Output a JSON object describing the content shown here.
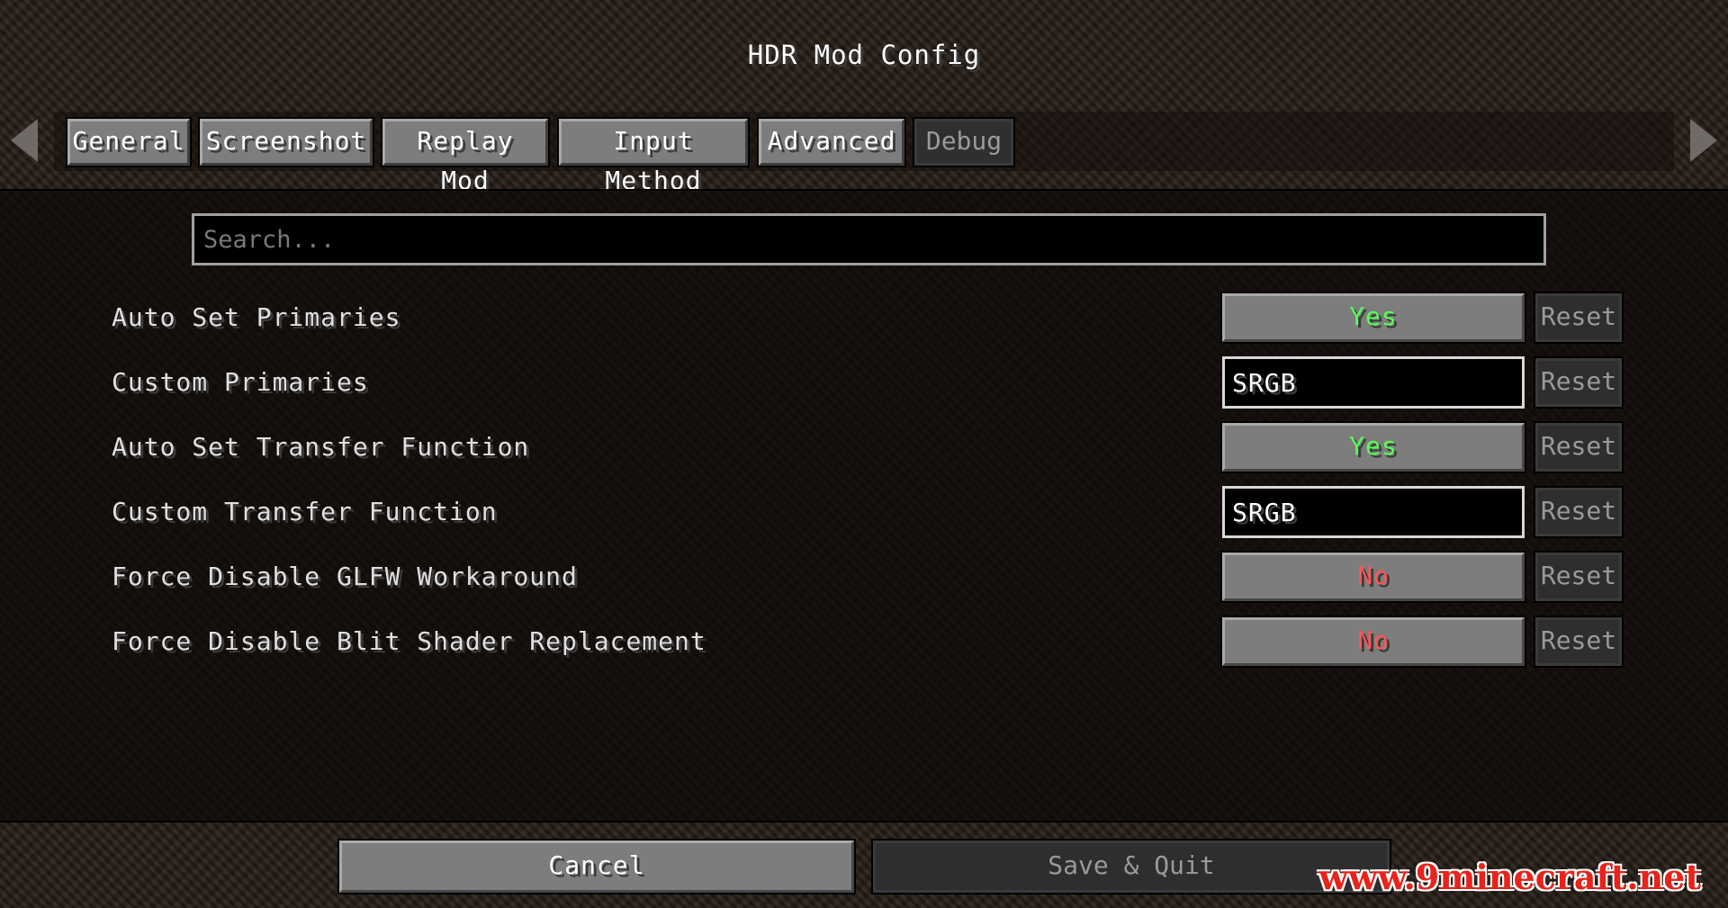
{
  "title": "HDR Mod Config",
  "tabs": [
    {
      "label": "General",
      "enabled": true
    },
    {
      "label": "Screenshot",
      "enabled": true
    },
    {
      "label": "Replay Mod",
      "enabled": true
    },
    {
      "label": "Input Method",
      "enabled": true
    },
    {
      "label": "Advanced",
      "enabled": true
    },
    {
      "label": "Debug",
      "enabled": false
    }
  ],
  "search": {
    "placeholder": "Search...",
    "value": ""
  },
  "options": [
    {
      "label": "Auto Set Primaries",
      "kind": "toggle",
      "value": "Yes",
      "reset": "Reset"
    },
    {
      "label": "Custom Primaries",
      "kind": "text",
      "value": "SRGB",
      "reset": "Reset"
    },
    {
      "label": "Auto Set Transfer Function",
      "kind": "toggle",
      "value": "Yes",
      "reset": "Reset"
    },
    {
      "label": "Custom Transfer Function",
      "kind": "text",
      "value": "SRGB",
      "reset": "Reset"
    },
    {
      "label": "Force Disable GLFW Workaround",
      "kind": "toggle",
      "value": "No",
      "reset": "Reset"
    },
    {
      "label": "Force Disable Blit Shader Replacement",
      "kind": "toggle",
      "value": "No",
      "reset": "Reset"
    }
  ],
  "buttons": {
    "cancel": "Cancel",
    "save": "Save & Quit"
  },
  "watermark": "www.9minecraft.net",
  "colors": {
    "yes": "#55ff55",
    "no": "#ff5555"
  }
}
